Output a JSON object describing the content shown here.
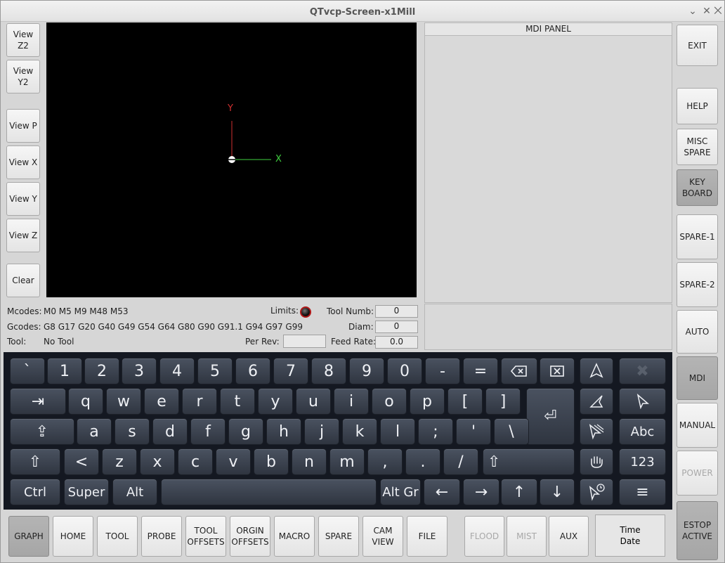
{
  "window": {
    "title": "QTvcp-Screen-x1Mill"
  },
  "view_buttons": {
    "z2": "View Z2",
    "y2": "View Y2",
    "p": "View P",
    "x": "View X",
    "y": "View Y",
    "z": "View Z",
    "clear": "Clear"
  },
  "graphics": {
    "axis_y": "Y",
    "axis_x": "X",
    "axis_y_color": "#d03030",
    "axis_x_color": "#40d040"
  },
  "mdi": {
    "title": "MDI PANEL"
  },
  "status": {
    "mcodes_label": "Mcodes:",
    "mcodes": "M0 M5 M9 M48 M53",
    "gcodes_label": "Gcodes:",
    "gcodes": "G8 G17 G20 G40 G49 G54 G64 G80 G90 G91.1 G94 G97 G99",
    "tool_label": "Tool:",
    "tool": "No Tool",
    "limits_label": "Limits:",
    "tool_numb_label": "Tool Numb:",
    "tool_numb": "0",
    "diam_label": "Diam:",
    "diam": "0",
    "per_rev_label": "Per Rev:",
    "per_rev": "",
    "feed_rate_label": "Feed Rate:",
    "feed_rate": "0.0"
  },
  "side_buttons": {
    "exit": "EXIT",
    "help": "HELP",
    "misc_spare": "MISC\nSPARE",
    "keyboard": "KEY\nBOARD",
    "spare1": "SPARE-1",
    "spare2": "SPARE-2",
    "auto": "AUTO",
    "mdi": "MDI",
    "manual": "MANUAL",
    "power": "POWER",
    "estop": "ESTOP\nACTIVE"
  },
  "keyboard": {
    "row1": [
      "`",
      "1",
      "2",
      "3",
      "4",
      "5",
      "6",
      "7",
      "8",
      "9",
      "0",
      "-",
      "="
    ],
    "row2": [
      "q",
      "w",
      "e",
      "r",
      "t",
      "y",
      "u",
      "i",
      "o",
      "p",
      "[",
      "]"
    ],
    "row3": [
      "a",
      "s",
      "d",
      "f",
      "g",
      "h",
      "j",
      "k",
      "l",
      ";",
      "'",
      "\\"
    ],
    "row4": [
      "<",
      "z",
      "x",
      "c",
      "v",
      "b",
      "n",
      "m",
      ",",
      ".",
      "/"
    ],
    "ctrl": "Ctrl",
    "super": "Super",
    "alt": "Alt",
    "altgr": "Alt Gr",
    "abc": "Abc",
    "num": "123",
    "tab_glyph": "⇥",
    "shift_glyph": "⇧",
    "shift2_glyph": "⇧",
    "caps_glyph": "⇪",
    "enter_glyph": "⏎",
    "left_glyph": "←",
    "right_glyph": "→",
    "up_glyph": "↑",
    "down_glyph": "↓",
    "menu_glyph": "≡"
  },
  "bottom_tabs": {
    "graph": "GRAPH",
    "home": "HOME",
    "tool": "TOOL",
    "probe": "PROBE",
    "tool_offsets": "TOOL\nOFFSETS",
    "orgin_offsets": "ORGIN\nOFFSETS",
    "macro": "MACRO",
    "spare": "SPARE",
    "cam_view": "CAM\nVIEW",
    "file": "FILE",
    "flood": "FLOOD",
    "mist": "MIST",
    "aux": "AUX"
  },
  "clock": {
    "time": "Time",
    "date": "Date"
  }
}
